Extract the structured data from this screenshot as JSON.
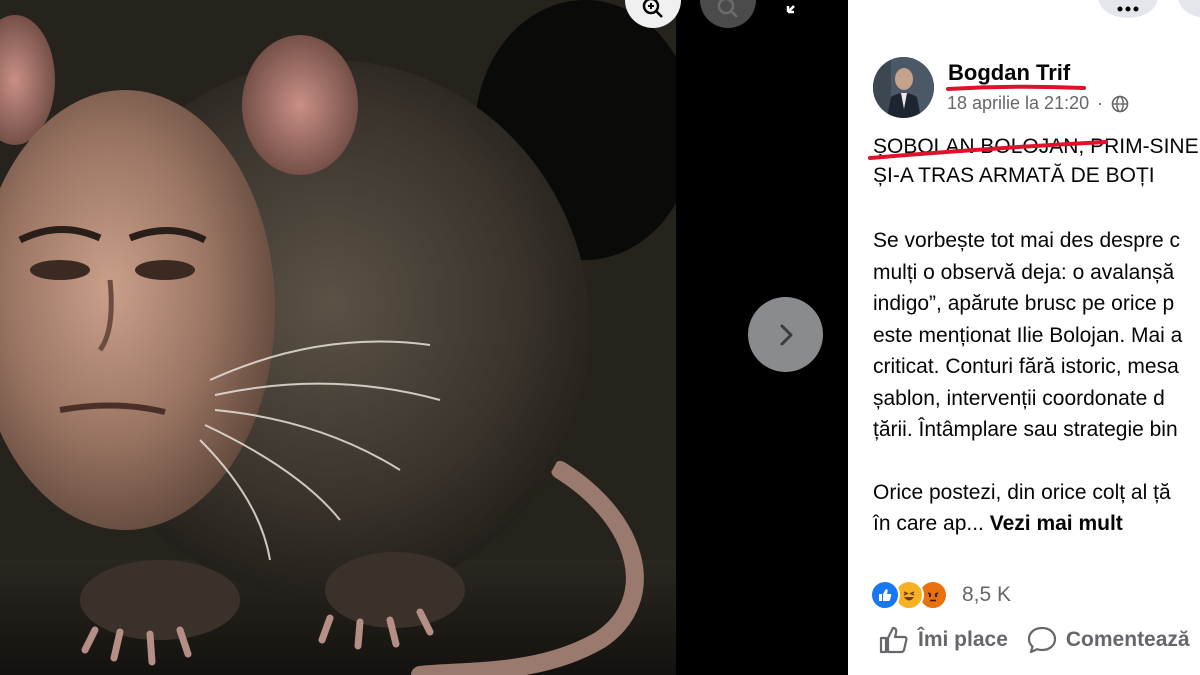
{
  "viewer": {
    "controls": [
      "zoom-in-icon",
      "zoom-out-icon",
      "expand-icon"
    ],
    "next_icon": "chevron-right-icon"
  },
  "post": {
    "author": "Bogdan Trif",
    "timestamp": "18 aprilie la 21:20",
    "audience_icon": "globe-icon",
    "title_lines": [
      "ȘOBOLAN BOLOJAN, PRIM-SINE",
      "ȘI-A TRAS ARMATĂ DE BOȚI"
    ],
    "paragraph1": [
      "Se vorbește tot mai des despre c",
      "mulți o observă deja: o avalanșă",
      "indigo”, apărute brusc pe orice p",
      "este menționat Ilie Bolojan. Mai a",
      "criticat. Conturi fără istoric, mesa",
      "șablon, intervenții coordonate d",
      "țării. Întâmplare sau strategie bin"
    ],
    "paragraph2": [
      "Orice postezi, din orice colț al ță"
    ],
    "paragraph2_last": "în care ap...",
    "see_more": "Vezi mai mult",
    "reaction_count": "8,5 K",
    "actions": {
      "like": "Îmi place",
      "comment": "Comentează"
    }
  },
  "colors": {
    "accent": "#1877f2",
    "annotation_red": "#e0112b",
    "text": "#050505",
    "muted": "#65676b"
  }
}
